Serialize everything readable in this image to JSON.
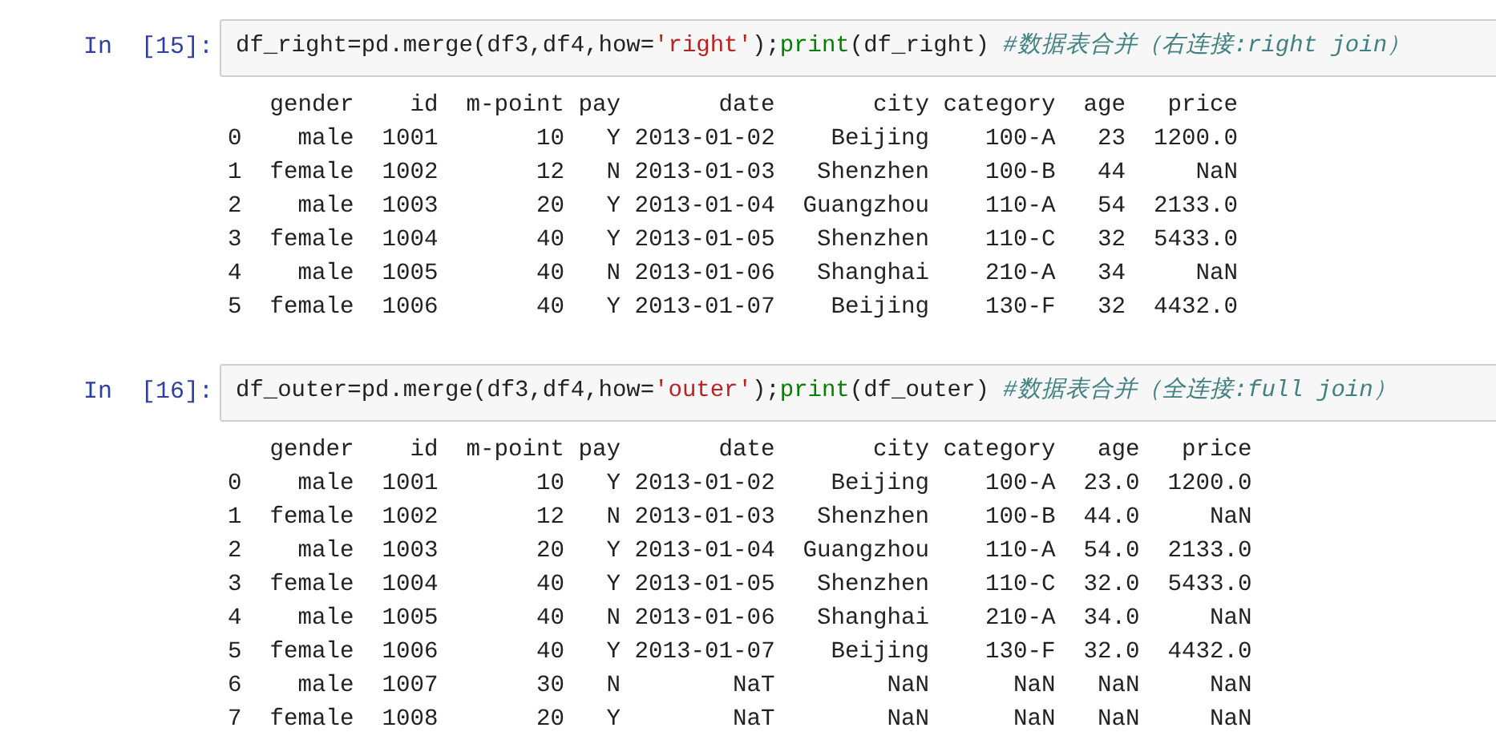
{
  "cells": [
    {
      "prompt": "In  [15]:",
      "code": [
        {
          "kind": "plain",
          "text": "df_right=pd.merge(df3,df4,how="
        },
        {
          "kind": "string",
          "text": "'right'"
        },
        {
          "kind": "plain",
          "text": ");"
        },
        {
          "kind": "builtin",
          "text": "print"
        },
        {
          "kind": "plain",
          "text": "(df_right) "
        },
        {
          "kind": "comment",
          "text": "#数据表合并（右连接:right join）"
        }
      ],
      "output": {
        "columns": [
          "gender",
          "id",
          "m-point",
          "pay",
          "date",
          "city",
          "category",
          "age",
          "price"
        ],
        "rows": [
          {
            "index": "0",
            "cells": [
              "male",
              "1001",
              "10",
              "Y",
              "2013-01-02",
              "Beijing",
              "100-A",
              "23",
              "1200.0"
            ]
          },
          {
            "index": "1",
            "cells": [
              "female",
              "1002",
              "12",
              "N",
              "2013-01-03",
              "Shenzhen",
              "100-B",
              "44",
              "NaN"
            ]
          },
          {
            "index": "2",
            "cells": [
              "male",
              "1003",
              "20",
              "Y",
              "2013-01-04",
              "Guangzhou",
              "110-A",
              "54",
              "2133.0"
            ]
          },
          {
            "index": "3",
            "cells": [
              "female",
              "1004",
              "40",
              "Y",
              "2013-01-05",
              "Shenzhen",
              "110-C",
              "32",
              "5433.0"
            ]
          },
          {
            "index": "4",
            "cells": [
              "male",
              "1005",
              "40",
              "N",
              "2013-01-06",
              "Shanghai",
              "210-A",
              "34",
              "NaN"
            ]
          },
          {
            "index": "5",
            "cells": [
              "female",
              "1006",
              "40",
              "Y",
              "2013-01-07",
              "Beijing",
              "130-F",
              "32",
              "4432.0"
            ]
          }
        ]
      }
    },
    {
      "prompt": "In  [16]:",
      "code": [
        {
          "kind": "plain",
          "text": "df_outer=pd.merge(df3,df4,how="
        },
        {
          "kind": "string",
          "text": "'outer'"
        },
        {
          "kind": "plain",
          "text": ");"
        },
        {
          "kind": "builtin",
          "text": "print"
        },
        {
          "kind": "plain",
          "text": "(df_outer) "
        },
        {
          "kind": "comment",
          "text": "#数据表合并（全连接:full join）"
        }
      ],
      "output": {
        "columns": [
          "gender",
          "id",
          "m-point",
          "pay",
          "date",
          "city",
          "category",
          "age",
          "price"
        ],
        "rows": [
          {
            "index": "0",
            "cells": [
              "male",
              "1001",
              "10",
              "Y",
              "2013-01-02",
              "Beijing",
              "100-A",
              "23.0",
              "1200.0"
            ]
          },
          {
            "index": "1",
            "cells": [
              "female",
              "1002",
              "12",
              "N",
              "2013-01-03",
              "Shenzhen",
              "100-B",
              "44.0",
              "NaN"
            ]
          },
          {
            "index": "2",
            "cells": [
              "male",
              "1003",
              "20",
              "Y",
              "2013-01-04",
              "Guangzhou",
              "110-A",
              "54.0",
              "2133.0"
            ]
          },
          {
            "index": "3",
            "cells": [
              "female",
              "1004",
              "40",
              "Y",
              "2013-01-05",
              "Shenzhen",
              "110-C",
              "32.0",
              "5433.0"
            ]
          },
          {
            "index": "4",
            "cells": [
              "male",
              "1005",
              "40",
              "N",
              "2013-01-06",
              "Shanghai",
              "210-A",
              "34.0",
              "NaN"
            ]
          },
          {
            "index": "5",
            "cells": [
              "female",
              "1006",
              "40",
              "Y",
              "2013-01-07",
              "Beijing",
              "130-F",
              "32.0",
              "4432.0"
            ]
          },
          {
            "index": "6",
            "cells": [
              "male",
              "1007",
              "30",
              "N",
              "NaT",
              "NaN",
              "NaN",
              "NaN",
              "NaN"
            ]
          },
          {
            "index": "7",
            "cells": [
              "female",
              "1008",
              "20",
              "Y",
              "NaT",
              "NaN",
              "NaN",
              "NaN",
              "NaN"
            ]
          }
        ]
      }
    }
  ]
}
